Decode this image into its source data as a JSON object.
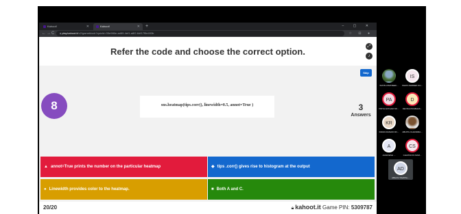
{
  "browser": {
    "tabs": [
      {
        "title": "Kahoot!"
      },
      {
        "title": "Kahoot!"
      }
    ],
    "new_tab": "+",
    "window_controls": "– ▢ ✕",
    "nav": {
      "back": "←",
      "forward": "→",
      "reload": "C"
    },
    "url_host": "play.kahoot.it",
    "url_path": "/v2/gameblock?quizId=35e986e-ad89-4ef1-a8f2-6df17f5e493b",
    "address_icons": "☆ ⊟ ●"
  },
  "quiz": {
    "question": "Refer the code and choose the correct option.",
    "skip_label": "Skip",
    "timer": "8",
    "code": "sns.heatmap(tips.corr(), linewidth=0.5, annot=True )",
    "answers_count": "3",
    "answers_label": "Answers",
    "options": [
      {
        "shape": "▲",
        "text": "annot=True prints the number on the particular heatmap",
        "color": "#e21b3c"
      },
      {
        "shape": "◆",
        "text": "tips .corr() gives rise to histogram at the output",
        "color": "#1368ce"
      },
      {
        "shape": "●",
        "text": "Linewidth provides color to the heatmap.",
        "color": "#d89e00"
      },
      {
        "shape": "■",
        "text": "Both A and C.",
        "color": "#26890c"
      }
    ],
    "progress": "20/20",
    "brand": "kahoot.it",
    "pin_label": "Game PIN:",
    "pin": "5309787"
  },
  "participants": [
    {
      "initials": "",
      "name": "SVNTH PRATEEK...",
      "avatar": "photo"
    },
    {
      "initials": "IS",
      "name": "ISHITA SHREEK KU...",
      "color": "#f6e7ee",
      "ring": "#ffffff"
    },
    {
      "initials": "PA",
      "name": "PRIYA AKTHAR NO...",
      "color": "#f3dce3",
      "ring": "#e21b3c"
    },
    {
      "initials": "D",
      "name": "DEVIKA PRABHAS...",
      "color": "#fde9b8",
      "ring": "#e21b3c"
    },
    {
      "initials": "KR",
      "name": "KIRAN RANAM NO...",
      "color": "#ead8c6",
      "ring": "#ffffff"
    },
    {
      "initials": "",
      "name": "ABIJITH CHANDRA...",
      "avatar": "photo2"
    },
    {
      "initials": "A",
      "name": "AGNIVESH ...",
      "color": "#e3e6f4",
      "ring": "#ffffff"
    },
    {
      "initials": "CS",
      "name": "CHAITANYA SOM...",
      "color": "#f6e7ee",
      "ring": "#e21b3c"
    },
    {
      "initials": "AD",
      "name": "ABHAS TAVATAL...",
      "color": "#cfd6e6",
      "ring": "#ffffff"
    }
  ]
}
